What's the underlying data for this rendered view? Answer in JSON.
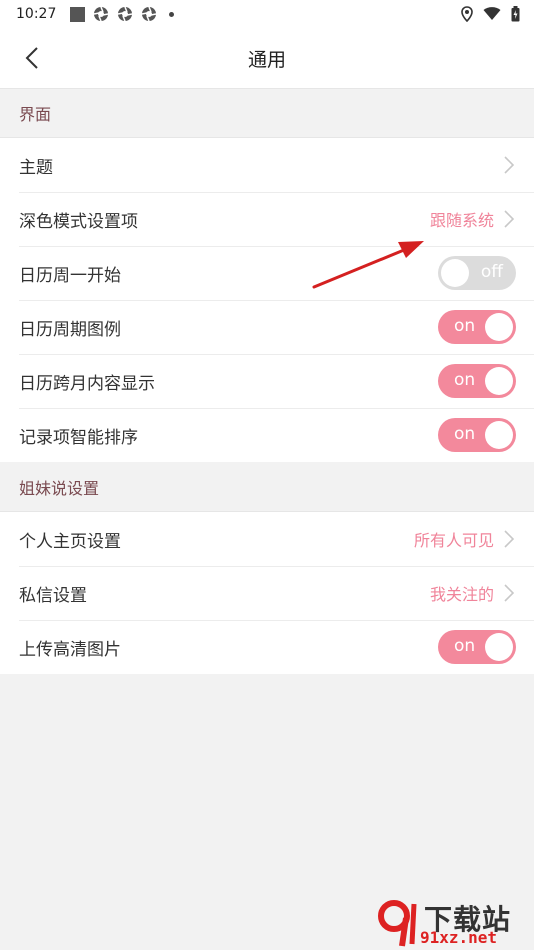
{
  "status_bar": {
    "time": "10:27"
  },
  "header": {
    "title": "通用"
  },
  "sections": [
    {
      "title": "界面",
      "rows": [
        {
          "label": "主题",
          "value": ""
        },
        {
          "label": "深色模式设置项",
          "value": "跟随系统"
        },
        {
          "label": "日历周一开始",
          "toggle": "off"
        },
        {
          "label": "日历周期图例",
          "toggle": "on"
        },
        {
          "label": "日历跨月内容显示",
          "toggle": "on"
        },
        {
          "label": "记录项智能排序",
          "toggle": "on"
        }
      ]
    },
    {
      "title": "姐妹说设置",
      "rows": [
        {
          "label": "个人主页设置",
          "value": "所有人可见"
        },
        {
          "label": "私信设置",
          "value": "我关注的"
        },
        {
          "label": "上传高清图片",
          "toggle": "on"
        }
      ]
    }
  ],
  "watermark": {
    "text": "下载站",
    "sub": "91xz.net"
  },
  "colors": {
    "accent": "#f3899c",
    "value_text": "#f0849a",
    "section_text": "#7a4a50",
    "arrow": "#d42020"
  }
}
